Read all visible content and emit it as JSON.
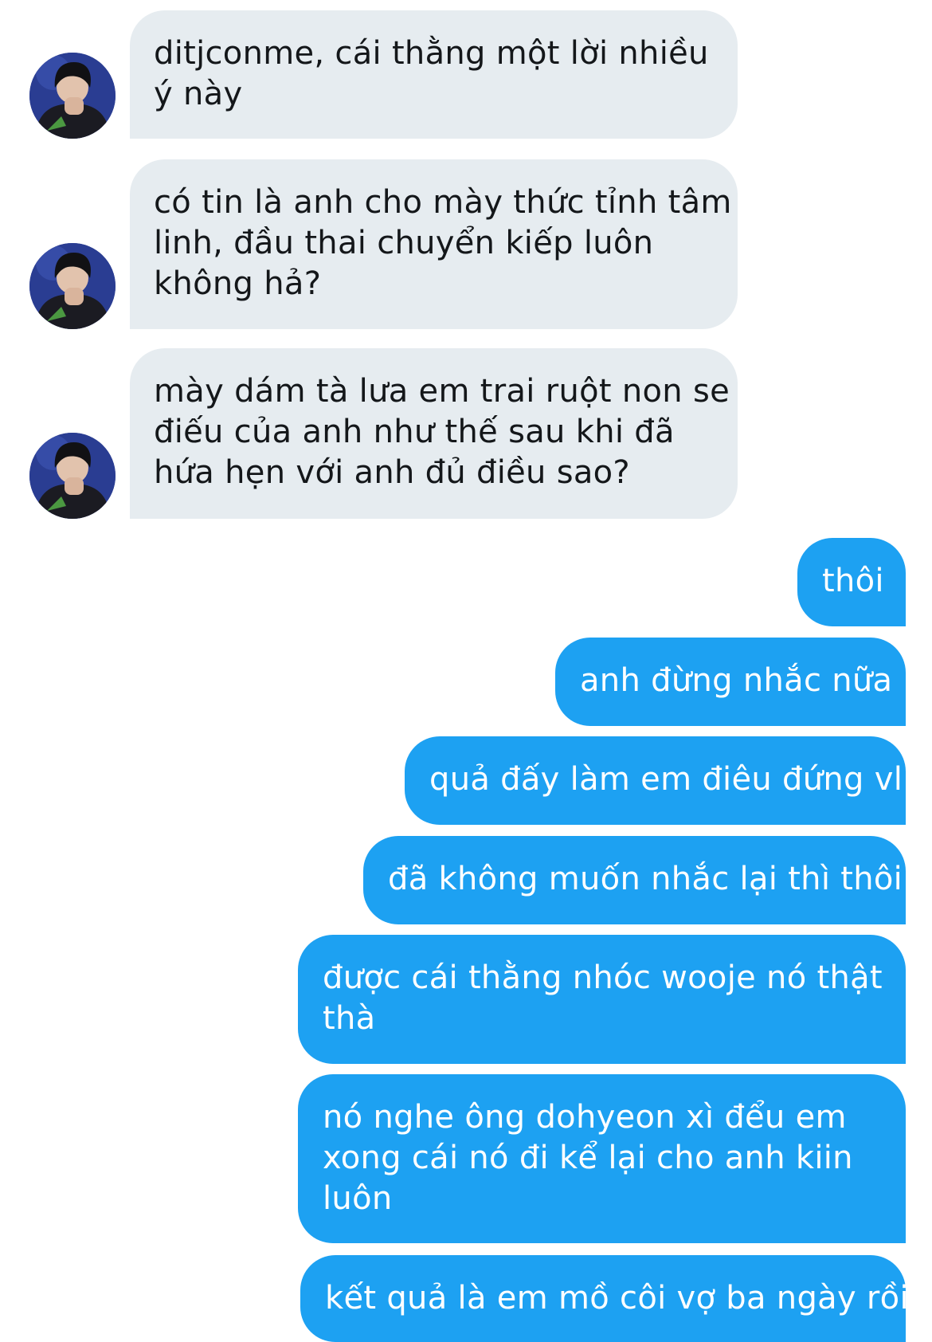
{
  "incoming": [
    {
      "lines": [
        "ditjconme, cái thằng một lời nhiều",
        "ý này"
      ]
    },
    {
      "lines": [
        "có tin là anh cho mày thức tỉnh tâm",
        "linh, đầu thai chuyển kiếp luôn",
        "không hả?"
      ]
    },
    {
      "lines": [
        "mày dám tà lưa em trai ruột non se",
        "điếu của anh như thế sau khi đã",
        "hứa hẹn với anh đủ điều sao?"
      ]
    }
  ],
  "outgoing": [
    {
      "lines": [
        "thôi"
      ]
    },
    {
      "lines": [
        "anh đừng nhắc nữa"
      ]
    },
    {
      "lines": [
        "quả đấy làm em điêu đứng vl"
      ]
    },
    {
      "lines": [
        "đã không muốn nhắc lại thì thôi"
      ]
    },
    {
      "lines": [
        "được cái thằng nhóc wooje nó thật",
        "thà"
      ]
    },
    {
      "lines": [
        "nó nghe ông dohyeon xì đểu em",
        "xong cái nó đi kể lại cho anh kiin",
        "luôn"
      ]
    },
    {
      "lines": [
        "kết quả là em mồ côi vợ ba ngày rồi"
      ]
    }
  ],
  "colors": {
    "incoming_bubble": "#e6ecf0",
    "incoming_text": "#14171a",
    "outgoing_bubble": "#1da1f2",
    "outgoing_text": "#ffffff",
    "avatar_background": "#2a3d92"
  },
  "icons": {
    "avatar": "user-avatar-photo"
  }
}
